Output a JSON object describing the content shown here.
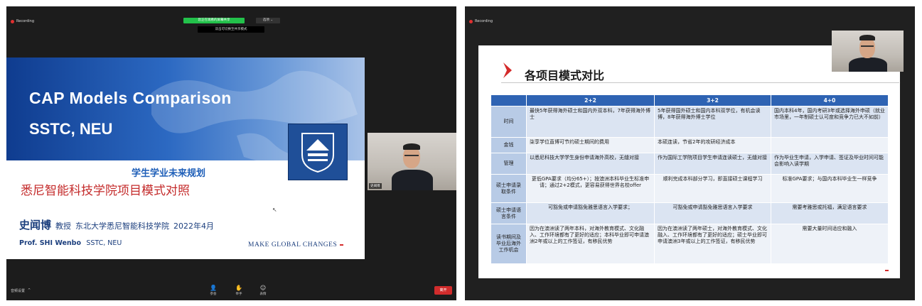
{
  "left_window": {
    "recording_label": "Recording",
    "share_bar_text": "您正在观看的屏幕共享",
    "share_options_label": "选项 ⌄",
    "share_hint_text": "双击可切换至共享模式",
    "slide": {
      "title_line1": "CAP Models Comparison",
      "title_line2": "SSTC, NEU",
      "subtitle_blue": "学生学业未来规划",
      "subtitle_red": "悉尼智能科技学院项目模式对照",
      "presenter_name": "史闻博",
      "presenter_title": "教授",
      "presenter_affiliation": "东北大学悉尼智能科技学院",
      "presenter_date": "2022年4月",
      "presenter_en_name": "Prof. SHI Wenbo",
      "presenter_en_affil": "SSTC, NEU",
      "tagline": "MAKE GLOBAL CHANGES"
    },
    "camera_label": "史闻博",
    "toolbar": {
      "left_label": "音频设置",
      "left_caret": "^",
      "items": [
        {
          "icon": "user-icon",
          "glyph": "👤",
          "label": "参会"
        },
        {
          "icon": "hand-icon",
          "glyph": "✋",
          "label": "举手"
        },
        {
          "icon": "reaction-icon",
          "glyph": "☺",
          "label": "表情"
        }
      ],
      "leave_label": "离开"
    }
  },
  "right_window": {
    "recording_label": "Recording",
    "slide": {
      "title": "各项目模式对比",
      "columns": [
        "",
        "2+2",
        "3+2",
        "4+0"
      ],
      "rows": [
        {
          "header": "时间",
          "cells": [
            "最快5年获得海外硕士和国内外双本科，7年获得海外博士",
            "5年获得国外硕士和国内本科双学位，有机会读博，8年获得海外博士学位",
            "国内本科4年，国内考研3年或选择海外申硕（就业市场里，一年制硕士认可度和竞争力已大不如前）"
          ]
        },
        {
          "header": "金钱",
          "cells": [
            "柒享学位直博可节约硕士期间的费用",
            "本硕连读，节省2年的攻研经济成本",
            ""
          ]
        },
        {
          "header": "管理",
          "cells": [
            "以悉尼科技大学学生身份申请海外高校，无缝对接",
            "作为国际工学院项目学生申请连读硕士，无缝对接",
            "作为毕业生申请，入学申请、签证及毕业时间可能会影响入读学期"
          ]
        },
        {
          "header": "硕士申请录取条件",
          "cells": [
            "更低GPA要求（均分65+）；按澳洲本科毕业生标准申请；通过2+2模式，更容易获得世界名校offer",
            "顺利完成本科部分学习，即直接硕士课程学习",
            "标准GPA要求；与国内本科毕业生一样竞争"
          ]
        },
        {
          "header": "硕士申请语言条件",
          "cells": [
            "可豁免或申请豁免雅思语言入学要求；",
            "可豁免或申请豁免雅思语言入学要求",
            "需要考雅思或托福，满足语言要求"
          ]
        },
        {
          "header": "读书期间及毕业后海外工作机会",
          "cells": [
            "因为在澳洲读了两年本科，对海外教育模式、文化融入、工作环境都有了更好的适应；本科毕业即可申请澳洲2年或以上的工作签证，有移民优势",
            "因为在澳洲读了两年硕士，对海外教育模式、文化融入、工作环境都有了更好的适应；硕士毕业即可申请澳洲3年或以上的工作签证，有移民优势",
            "需要大量时间适应和融入"
          ]
        }
      ]
    }
  }
}
